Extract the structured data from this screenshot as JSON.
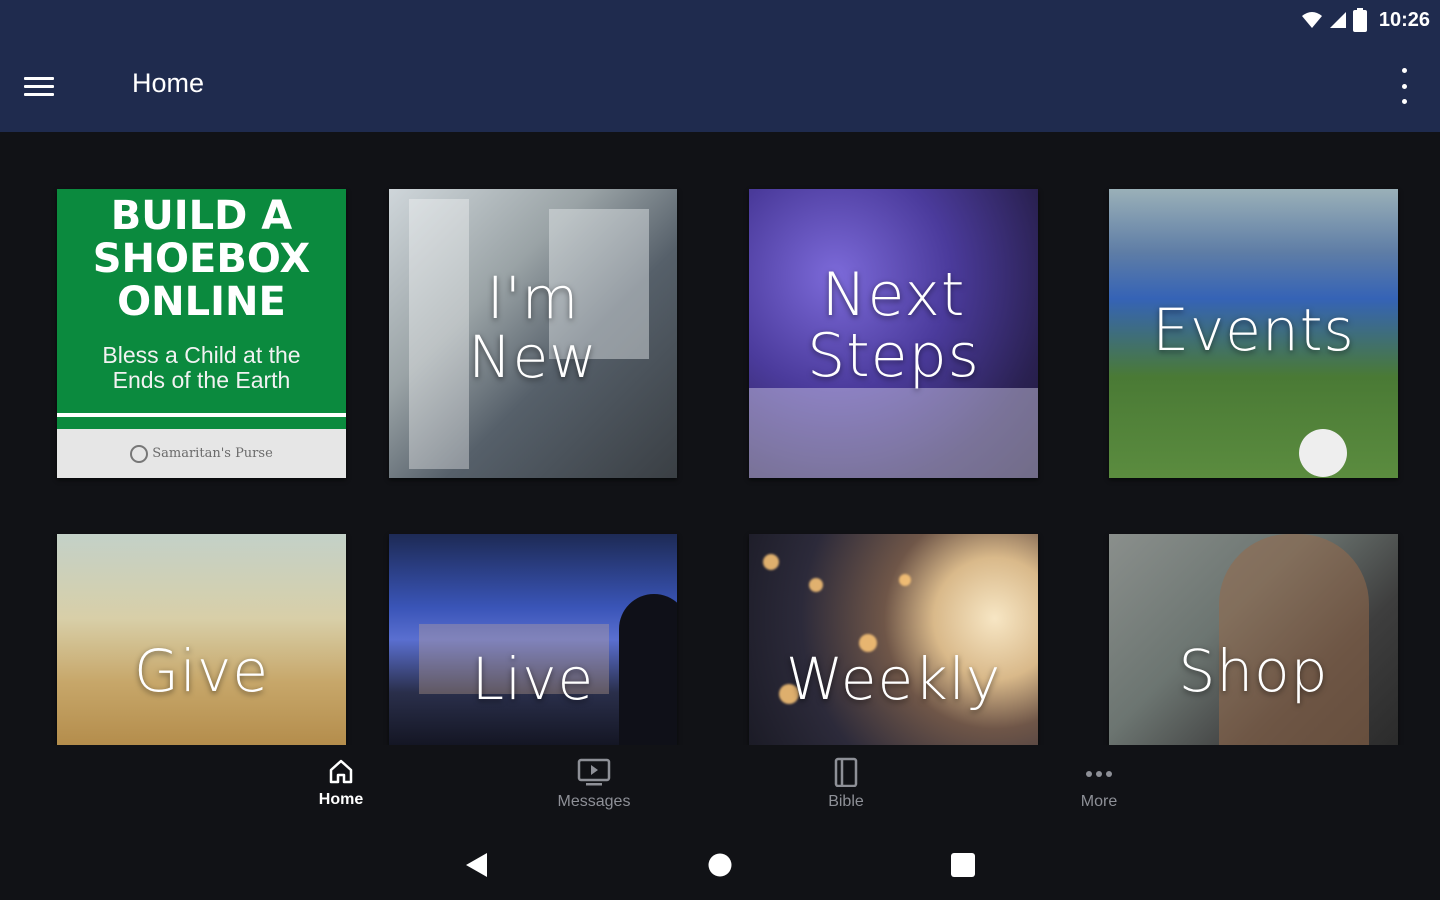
{
  "status_bar": {
    "time": "10:26",
    "icons": [
      "wifi-icon",
      "cellular-signal-icon",
      "battery-icon"
    ]
  },
  "app_bar": {
    "title": "Home",
    "menu_icon": "hamburger-menu-icon",
    "overflow_icon": "more-vertical-icon",
    "background_color": "#1f2b4e"
  },
  "tiles": {
    "shoebox": {
      "headline": "BUILD A SHOEBOX ONLINE",
      "subtitle": "Bless a Child at the Ends of the Earth",
      "footer": "Samaritan's Purse",
      "background_color": "#0b8a3e"
    },
    "new": {
      "label": "I'm New"
    },
    "next_steps": {
      "label": "Next Steps"
    },
    "events": {
      "label": "Events"
    },
    "give": {
      "label": "Give"
    },
    "live": {
      "label": "Live"
    },
    "weekly": {
      "label": "Weekly"
    },
    "shop": {
      "label": "Shop"
    }
  },
  "bottom_nav": {
    "items": [
      {
        "label": "Home",
        "icon": "home-icon",
        "active": true
      },
      {
        "label": "Messages",
        "icon": "tv-play-icon",
        "active": false
      },
      {
        "label": "Bible",
        "icon": "book-icon",
        "active": false
      },
      {
        "label": "More",
        "icon": "more-horizontal-icon",
        "active": false
      }
    ]
  },
  "system_nav": {
    "buttons": [
      "back-icon",
      "home-circle-icon",
      "recents-square-icon"
    ]
  }
}
